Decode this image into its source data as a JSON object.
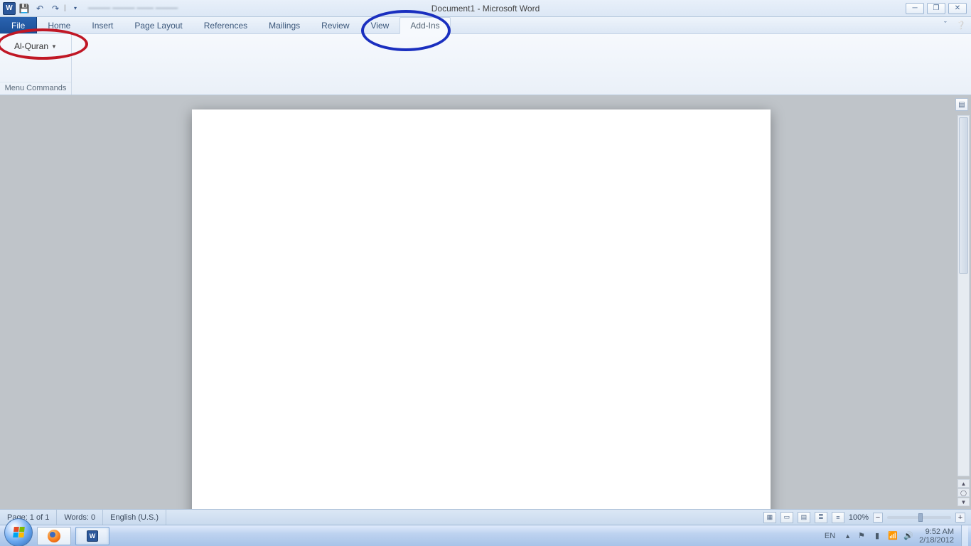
{
  "title": "Document1  -  Microsoft Word",
  "ribbon": {
    "file_label": "File",
    "tabs": [
      "Home",
      "Insert",
      "Page Layout",
      "References",
      "Mailings",
      "Review",
      "View",
      "Add-Ins"
    ],
    "active_tab_index": 7,
    "addin_button_label": "Al-Quran",
    "group_label": "Menu Commands"
  },
  "status": {
    "page": "Page: 1 of 1",
    "words": "Words: 0",
    "language": "English (U.S.)",
    "zoom": "100%"
  },
  "tray": {
    "lang": "EN",
    "time": "9:52 AM",
    "date": "2/18/2012"
  },
  "annotation_colors": {
    "red": "#c01725",
    "blue": "#1a2fbf"
  }
}
